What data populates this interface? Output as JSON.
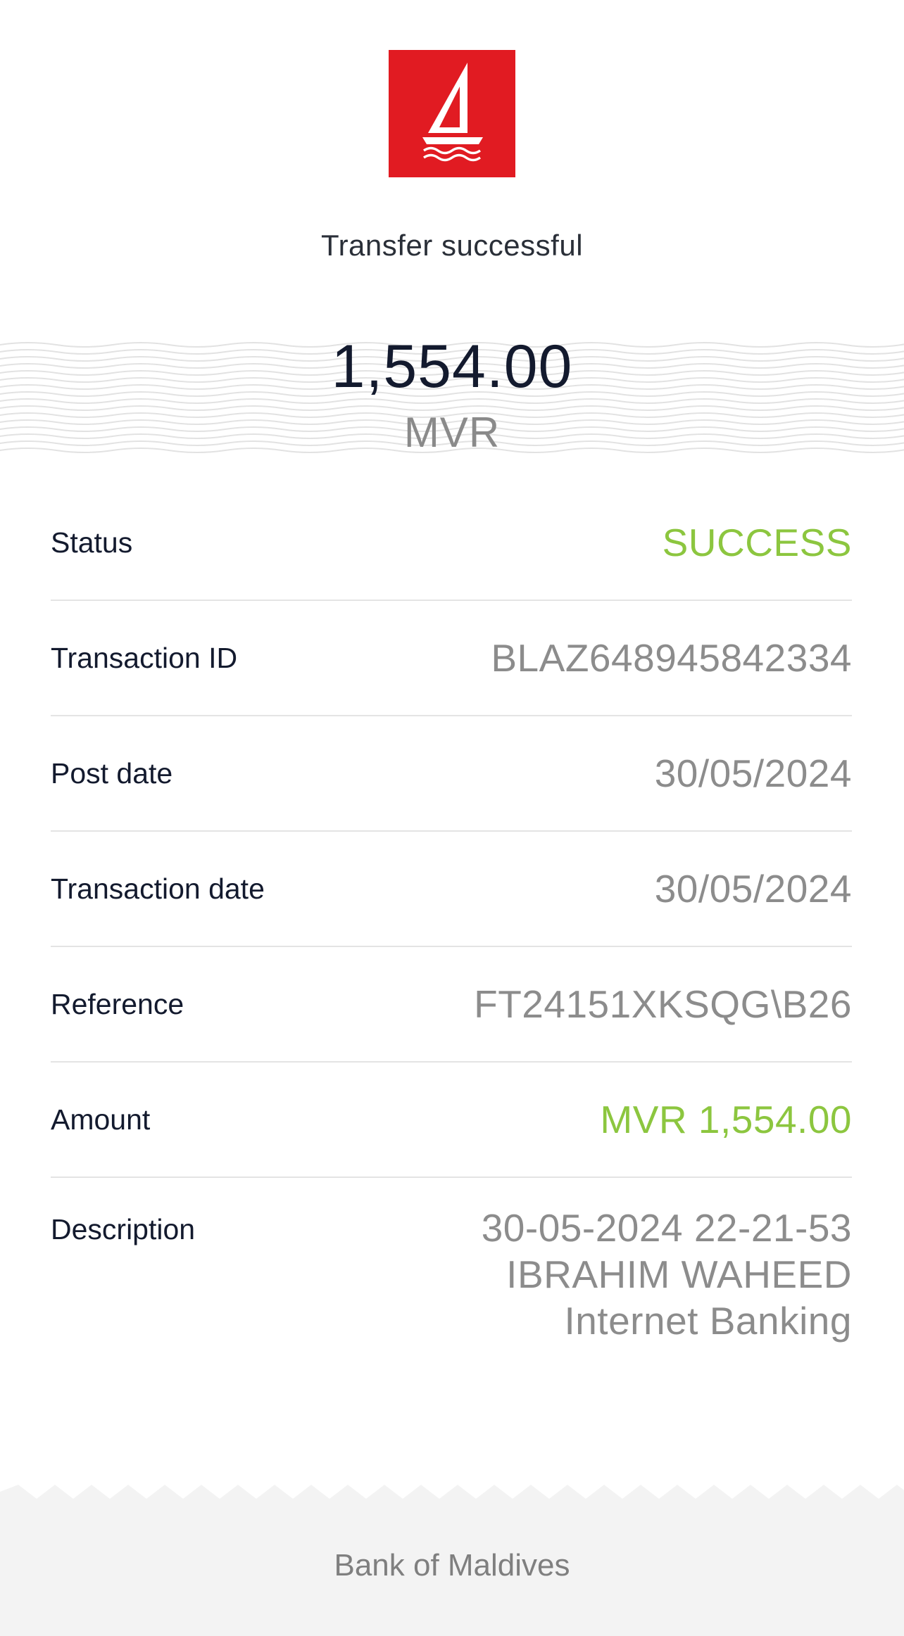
{
  "logo": {
    "name": "bank-sailboat-logo",
    "color": "#e11b22"
  },
  "headline": "Transfer successful",
  "summary": {
    "amount": "1,554.00",
    "currency": "MVR"
  },
  "details": {
    "status": {
      "label": "Status",
      "value": "SUCCESS"
    },
    "transaction_id": {
      "label": "Transaction ID",
      "value": "BLAZ648945842334"
    },
    "post_date": {
      "label": "Post date",
      "value": "30/05/2024"
    },
    "transaction_date": {
      "label": "Transaction date",
      "value": "30/05/2024"
    },
    "reference": {
      "label": "Reference",
      "value": "FT24151XKSQG\\B26"
    },
    "amount": {
      "label": "Amount",
      "value": "MVR 1,554.00"
    },
    "description": {
      "label": "Description",
      "lines": [
        "30-05-2024 22-21-53",
        "IBRAHIM WAHEED",
        "Internet Banking"
      ]
    }
  },
  "footer": {
    "text": "Bank of Maldives"
  },
  "colors": {
    "success": "#8cc63f",
    "text_dark": "#131a2e",
    "text_muted": "#8c8c8c"
  }
}
